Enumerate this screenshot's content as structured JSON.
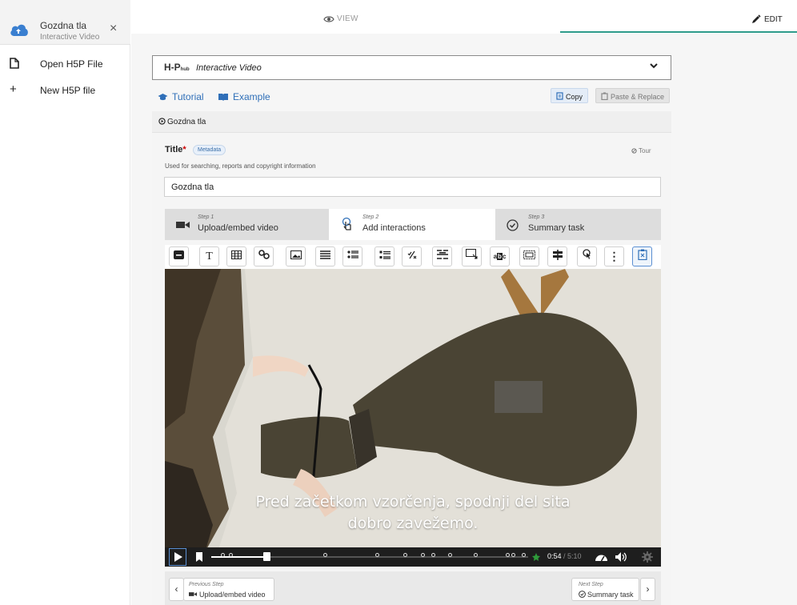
{
  "sidebar": {
    "file_name": "Gozdna tla",
    "file_type": "Interactive Video",
    "items": [
      {
        "label": "Open H5P File",
        "icon": "file-icon"
      },
      {
        "label": "New H5P file",
        "icon": "plus-icon"
      }
    ]
  },
  "topbar": {
    "view_label": "VIEW",
    "edit_label": "EDIT",
    "accent_color": "#2e9b8a"
  },
  "editor": {
    "library_logo": "H-P",
    "library_logo_small": "hub",
    "library_name": "Interactive Video",
    "tutorial_label": "Tutorial",
    "example_label": "Example",
    "copy_label": "Copy",
    "paste_label": "Paste & Replace",
    "section_title": "Gozdna tla",
    "title_label": "Title",
    "title_required": "*",
    "metadata_label": "Metadata",
    "tour_label": "Tour",
    "title_description": "Used for searching, reports and copyright information",
    "title_value": "Gozdna tla"
  },
  "steps": [
    {
      "number": "Step 1",
      "label": "Upload/embed video",
      "icon": "video-camera-icon"
    },
    {
      "number": "Step 2",
      "label": "Add interactions",
      "icon": "touch-icon",
      "active": true
    },
    {
      "number": "Step 3",
      "label": "Summary task",
      "icon": "check-circle-icon"
    }
  ],
  "toolbar": {
    "items": [
      "label-icon",
      "text-icon",
      "table-icon",
      "link-icon",
      "image-icon",
      "statements-icon",
      "single-choice-icon",
      "multiple-choice-icon",
      "true-false-icon",
      "fill-blanks-icon",
      "drag-question-icon",
      "mark-words-icon",
      "drag-text-icon",
      "crossroads-icon",
      "navigation-hotspot-icon",
      "more-icon",
      "paste-icon"
    ],
    "text_icon_glyph": "T",
    "more_glyph": "⋮"
  },
  "video": {
    "subtitle_line1": "Pred začetkom vzorčenja, spodnji del sita",
    "subtitle_line2": "dobro zavežemo.",
    "time_current": "0:54",
    "time_separator": " / ",
    "time_total": "5:10",
    "progress_fraction": 0.174
  },
  "footer": {
    "prev_small": "Previous Step",
    "prev_label": "Upload/embed video",
    "next_small": "Next Step",
    "next_label": "Summary task"
  }
}
